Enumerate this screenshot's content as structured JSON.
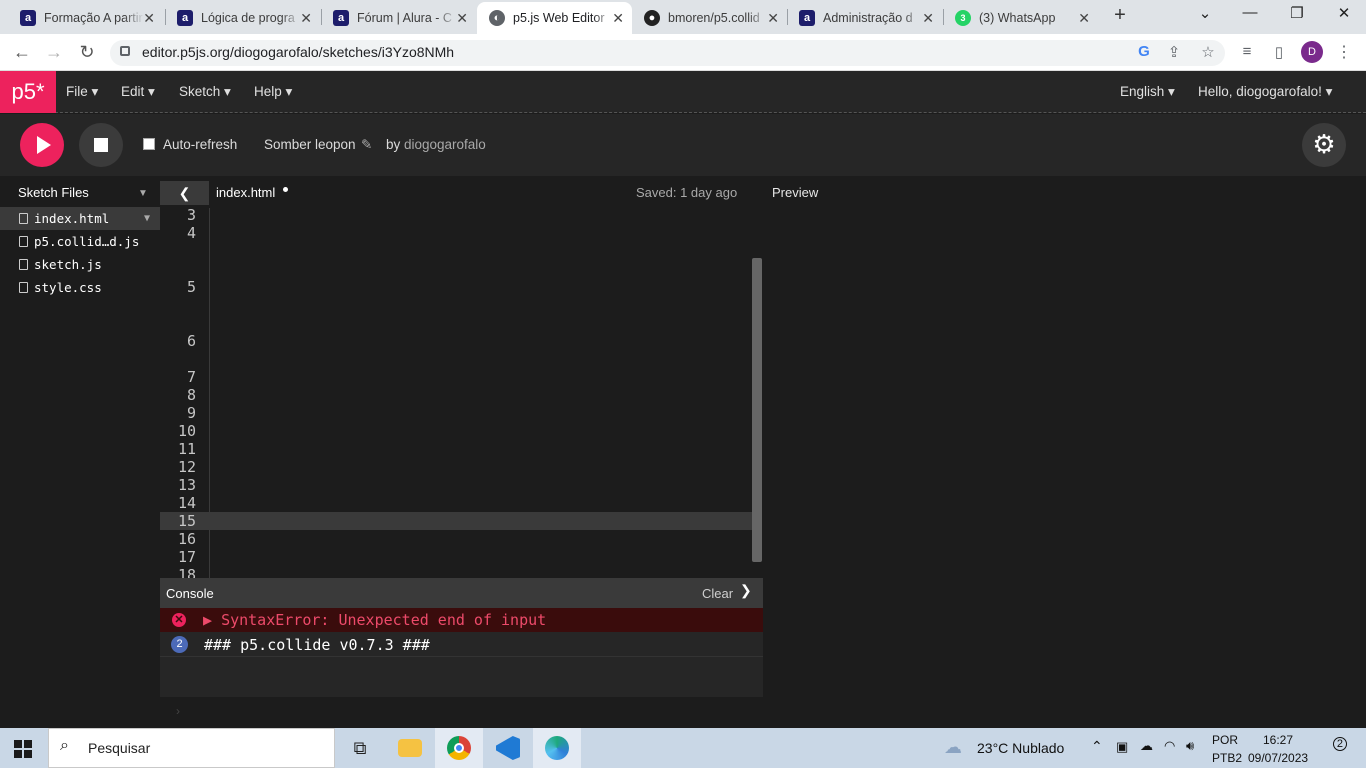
{
  "browser": {
    "tabs": [
      {
        "label": "Formação A partir",
        "icon": "alura-icon"
      },
      {
        "label": "Lógica de progra",
        "icon": "alura-icon"
      },
      {
        "label": "Fórum | Alura - C",
        "icon": "alura-icon"
      },
      {
        "label": "p5.js Web Editor",
        "icon": "p5-icon"
      },
      {
        "label": "bmoren/p5.collid",
        "icon": "github-icon"
      },
      {
        "label": "Administração d",
        "icon": "alura-icon"
      },
      {
        "label": "(3) WhatsApp",
        "icon": "whatsapp-icon"
      }
    ],
    "url": "editor.p5js.org/diogogarofalo/sketches/i3Yzo8NMh",
    "avatar_letter": "D"
  },
  "p5nav": {
    "logo": "p5*",
    "menus": [
      "File",
      "Edit",
      "Sketch",
      "Help"
    ],
    "language": "English",
    "greeting": "Hello, diogogarofalo!"
  },
  "toolbar": {
    "auto_refresh": "Auto-refresh",
    "sketch_name": "Somber leopon",
    "by": "by",
    "author": "diogogarofalo"
  },
  "sidebar": {
    "title": "Sketch Files",
    "files": [
      "index.html",
      "p5.collid…d.js",
      "sketch.js",
      "style.css"
    ]
  },
  "editor": {
    "filename": "index.html",
    "saved": "Saved: 1 day ago",
    "preview": "Preview",
    "line_numbers": [
      "3",
      "4",
      "5",
      "6",
      "7",
      "8",
      "9",
      "10",
      "11",
      "12",
      "13",
      "14",
      "15",
      "16",
      "17",
      "18"
    ]
  },
  "console": {
    "title": "Console",
    "clear": "Clear",
    "error": "SyntaxError: Unexpected end of input",
    "log_count": "2",
    "log": "### p5.collide v0.7.3 ###"
  },
  "taskbar": {
    "search": "Pesquisar",
    "weather": "23°C  Nublado",
    "lang1": "POR",
    "lang2": "PTB2",
    "time": "16:27",
    "date": "09/07/2023",
    "notifications": "2"
  },
  "colors": {
    "p5_pink": "#ed225d",
    "editor_bg": "#1c1c1c",
    "string_green": "#58a10b",
    "attr_blue": "#0b7ca9"
  }
}
